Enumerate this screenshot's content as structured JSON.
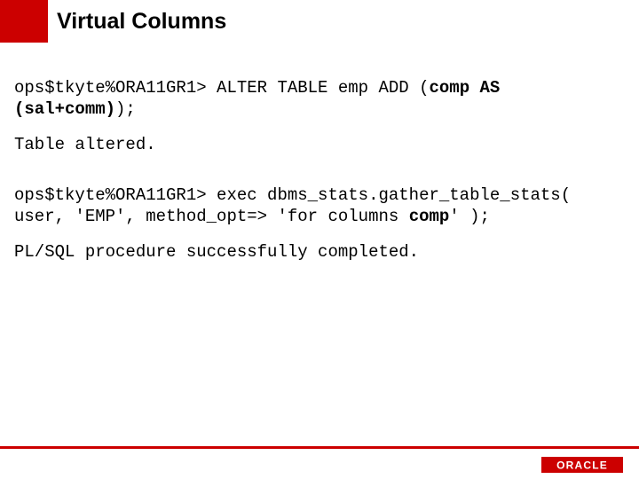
{
  "slide": {
    "title": "Virtual Columns",
    "block1_prefix": "ops$tkyte%ORA11GR1> ALTER TABLE emp ADD (",
    "block1_bold": "comp AS (sal+comm)",
    "block1_suffix": ");",
    "block2": "Table altered.",
    "block3_prefix": "ops$tkyte%ORA11GR1> exec dbms_stats.gather_table_stats( user, 'EMP', method_opt=> 'for columns ",
    "block3_bold": "comp",
    "block3_suffix": "' );",
    "block4": "PL/SQL procedure successfully completed.",
    "logo_text": "ORACLE"
  }
}
